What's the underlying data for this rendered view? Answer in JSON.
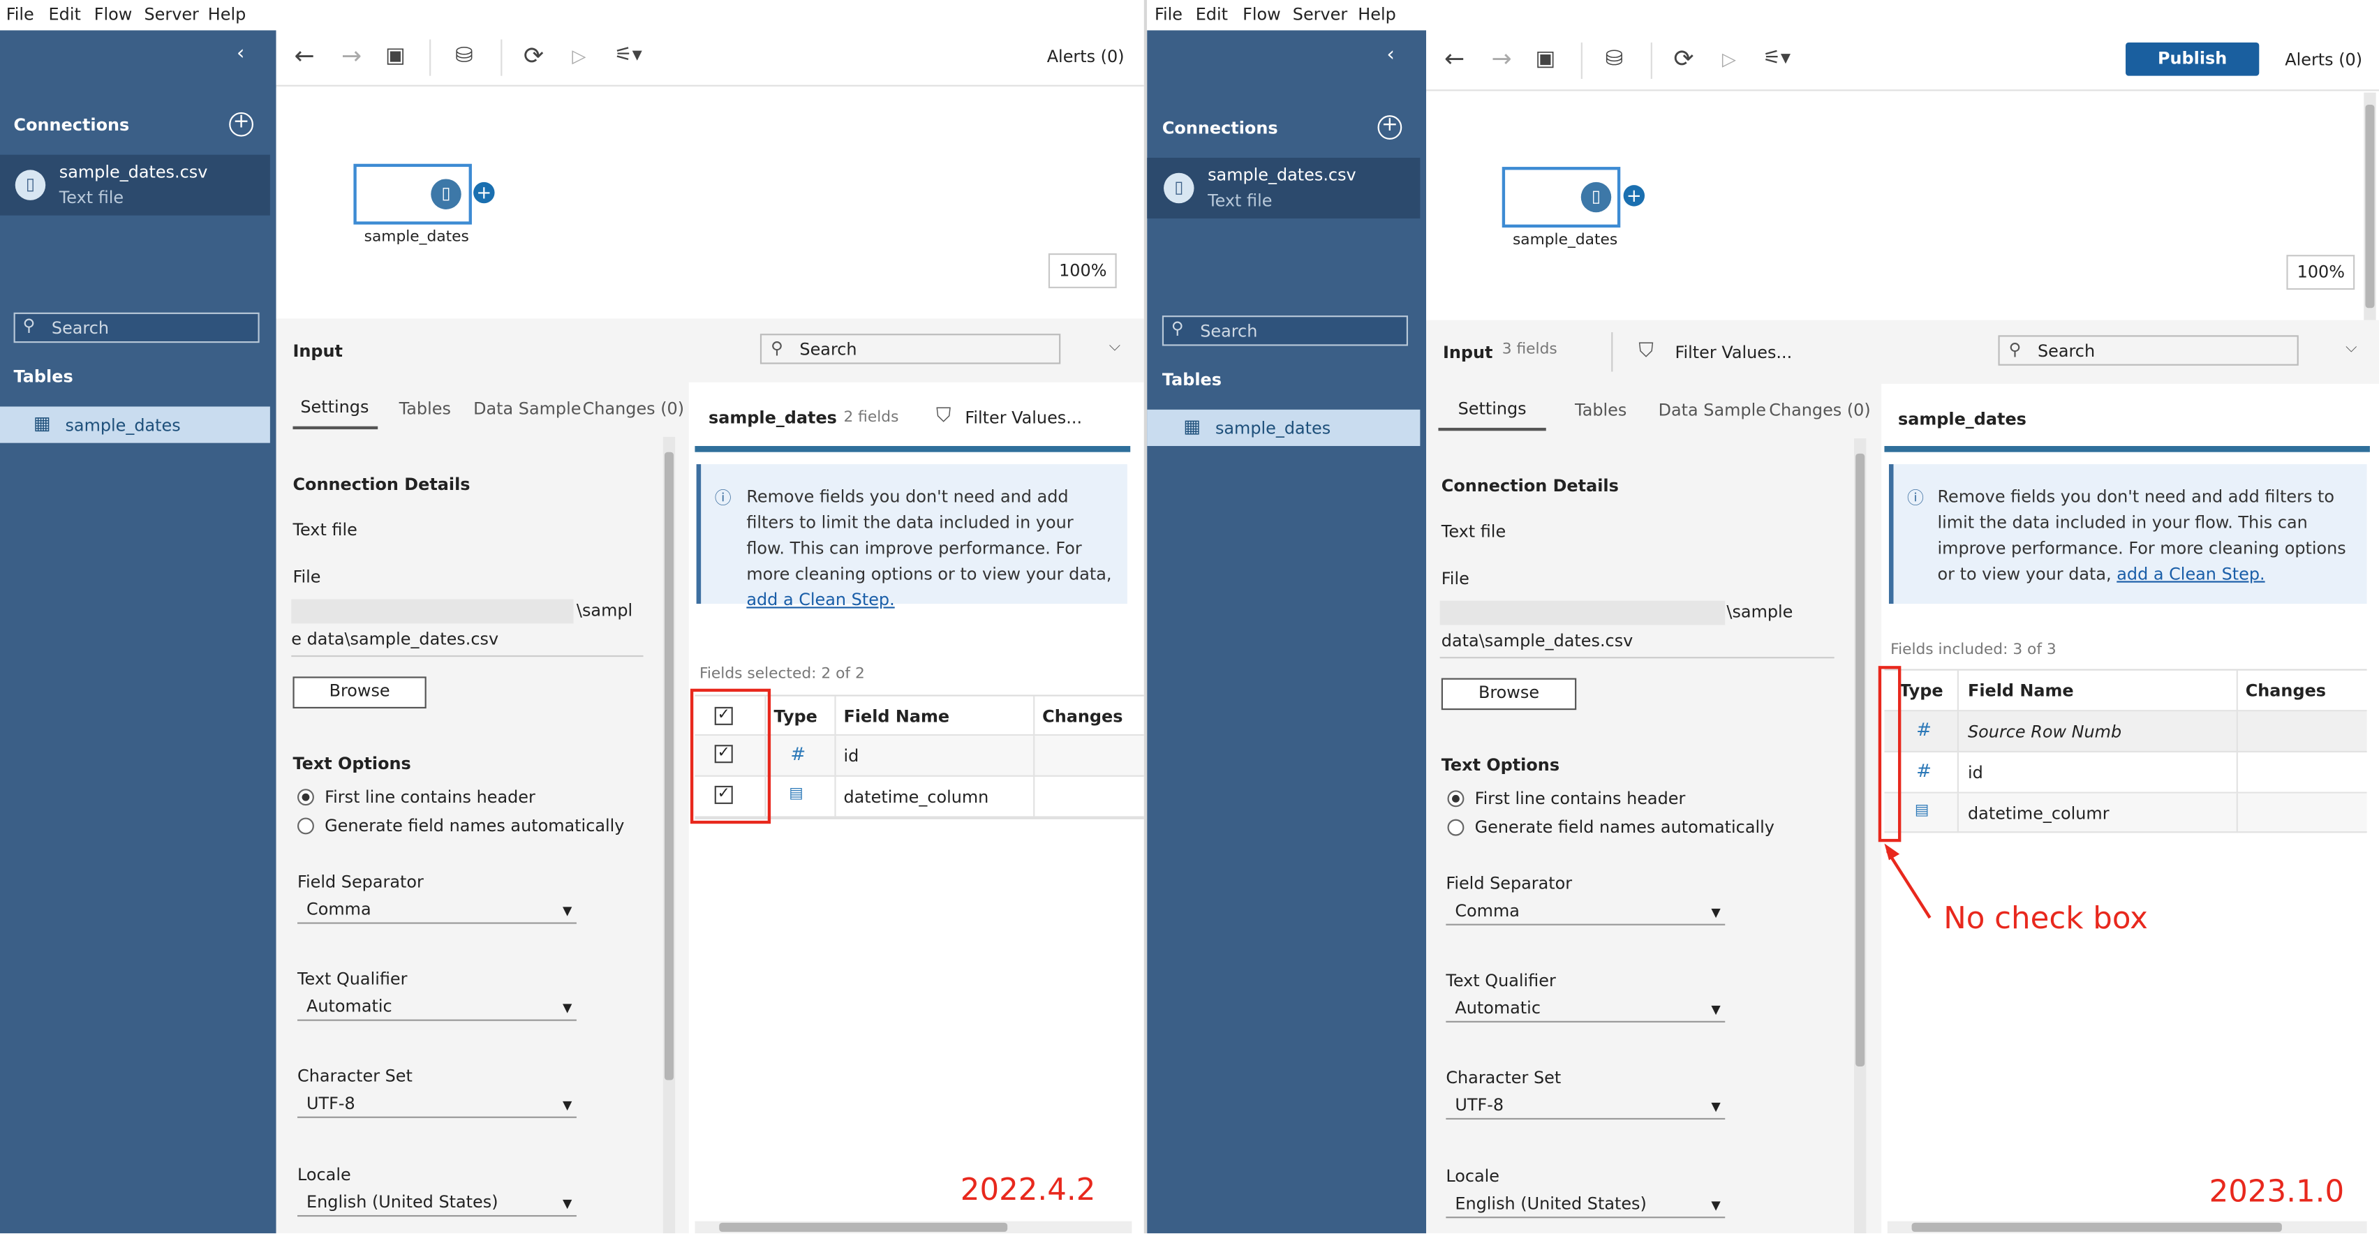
{
  "menu": [
    "File",
    "Edit",
    "Flow",
    "Server",
    "Help"
  ],
  "left": {
    "alerts": "Alerts (0)",
    "connections_title": "Connections",
    "conn_name": "sample_dates.csv",
    "conn_type": "Text file",
    "search_placeholder": "Search",
    "tables_title": "Tables",
    "table_item": "sample_dates",
    "node_label": "sample_dates",
    "zoom": "100%",
    "input_title": "Input",
    "input_search": "Search",
    "tabs": [
      "Settings",
      "Tables",
      "Data Sample",
      "Changes (0)"
    ],
    "connection_details": "Connection Details",
    "text_file": "Text file",
    "file_label": "File",
    "file_path_1": "\\sampl",
    "file_path_2": "e data\\sample_dates.csv",
    "browse": "Browse",
    "text_options": "Text Options",
    "radio1": "First line contains header",
    "radio2": "Generate field names automatically",
    "field_sep_label": "Field Separator",
    "field_sep_value": "Comma",
    "qual_label": "Text Qualifier",
    "qual_value": "Automatic",
    "charset_label": "Character Set",
    "charset_value": "UTF-8",
    "locale_label": "Locale",
    "locale_value": "English (United States)",
    "right_title": "sample_dates",
    "right_fields": "2 fields",
    "filter": "Filter Values...",
    "info_text": "Remove fields you don't need and add filters to limit the data included in your flow. This can improve performance. For more cleaning options or to view your data,",
    "info_link": "add a Clean Step.",
    "fields_selected": "Fields selected: 2 of 2",
    "col_type": "Type",
    "col_name": "Field Name",
    "col_changes": "Changes",
    "rows": [
      "id",
      "datetime_column"
    ],
    "version": "2022.4.2"
  },
  "right": {
    "publish": "Publish",
    "alerts": "Alerts (0)",
    "connections_title": "Connections",
    "conn_name": "sample_dates.csv",
    "conn_type": "Text file",
    "search_placeholder": "Search",
    "tables_title": "Tables",
    "table_item": "sample_dates",
    "node_label": "sample_dates",
    "zoom": "100%",
    "input_title": "Input",
    "input_fields": "3 fields",
    "filter": "Filter Values...",
    "input_search": "Search",
    "tabs": [
      "Settings",
      "Tables",
      "Data Sample",
      "Changes (0)"
    ],
    "connection_details": "Connection Details",
    "text_file": "Text file",
    "file_label": "File",
    "file_path_1": "\\sample",
    "file_path_2": "data\\sample_dates.csv",
    "browse": "Browse",
    "text_options": "Text Options",
    "radio1": "First line contains header",
    "radio2": "Generate field names automatically",
    "field_sep_label": "Field Separator",
    "field_sep_value": "Comma",
    "qual_label": "Text Qualifier",
    "qual_value": "Automatic",
    "charset_label": "Character Set",
    "charset_value": "UTF-8",
    "locale_label": "Locale",
    "locale_value": "English (United States)",
    "right_title": "sample_dates",
    "info_text": "Remove fields you don't need and add filters to limit the data included in your flow. This can improve performance. For more cleaning options or to view your data,",
    "info_link": "add a Clean Step.",
    "fields_included": "Fields included: 3 of 3",
    "col_type": "Type",
    "col_name": "Field Name",
    "col_changes": "Changes",
    "rows": [
      "Source Row Numb",
      "id",
      "datetime_columr"
    ],
    "annotation": "No check box",
    "version": "2023.1.0"
  }
}
